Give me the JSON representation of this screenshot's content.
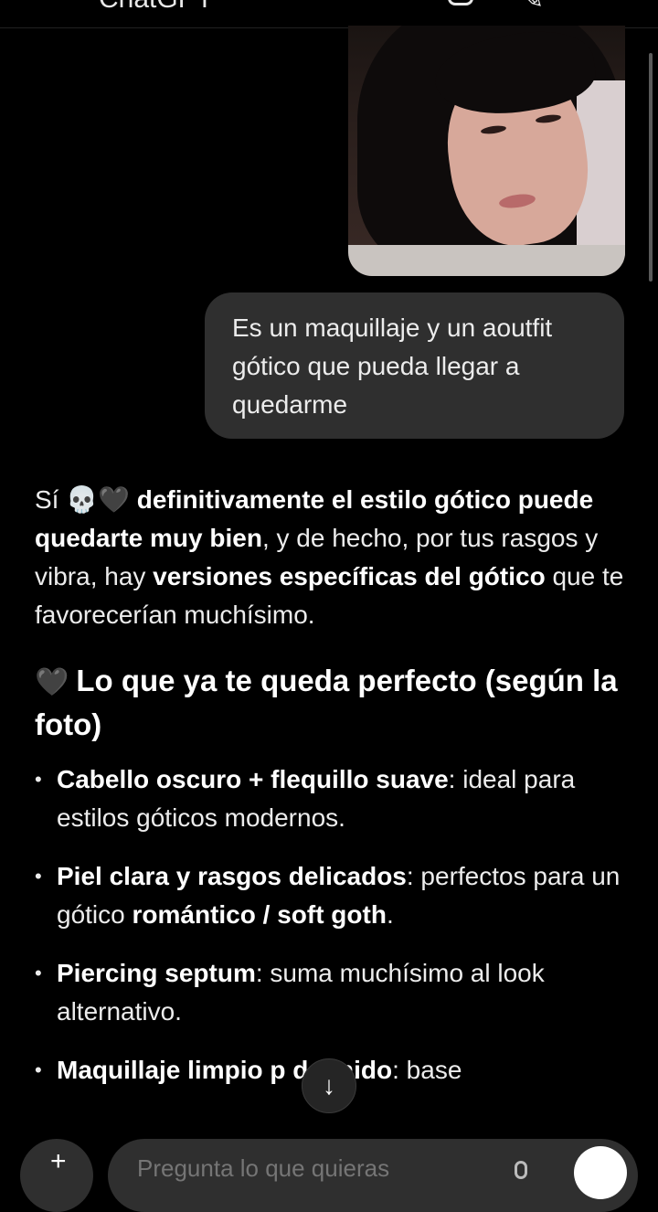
{
  "header": {
    "title": "ChatGPT"
  },
  "user_message": {
    "text": "Es un maquillaje y un aoutfit gótico que pueda llegar a quedarme"
  },
  "response": {
    "intro": [
      {
        "t": "Sí ",
        "b": false
      },
      {
        "t": "💀🖤",
        "b": false,
        "emoji": true
      },
      {
        "t": " definitivamente el estilo gótico puede quedarte muy bien",
        "b": true
      },
      {
        "t": ", y de hecho, por tus rasgos y vibra, hay ",
        "b": false
      },
      {
        "t": "versiones específicas del gótico",
        "b": true
      },
      {
        "t": " que te favorecerían muchísimo.",
        "b": false
      }
    ],
    "section1": {
      "emoji": "🖤",
      "heading": "Lo que ya te queda perfecto (según la foto)"
    },
    "bullets": [
      [
        {
          "t": "Cabello oscuro + flequillo suave",
          "b": true
        },
        {
          "t": ": ideal para estilos góticos modernos.",
          "b": false
        }
      ],
      [
        {
          "t": "Piel clara y rasgos delicados",
          "b": true
        },
        {
          "t": ": perfectos para un gótico ",
          "b": false
        },
        {
          "t": "romántico / soft goth",
          "b": true
        },
        {
          "t": ".",
          "b": false
        }
      ],
      [
        {
          "t": "Piercing septum",
          "b": true
        },
        {
          "t": ": suma muchísimo al look alternativo.",
          "b": false
        }
      ],
      [
        {
          "t": "Maquillaje limpio p",
          "b": true
        },
        {
          "t": "    ",
          "b": false
        },
        {
          "t": "definido",
          "b": true
        },
        {
          "t": ": base",
          "b": false
        }
      ]
    ]
  },
  "composer": {
    "placeholder": "Pregunta lo que quieras"
  },
  "icons": {
    "scroll_down": "arrow-down-icon",
    "plus": "plus-icon",
    "mic": "mic-icon",
    "send": "voice-icon"
  },
  "colors": {
    "background": "#000000",
    "bubble": "#2f2f2f",
    "text": "#ececec"
  }
}
